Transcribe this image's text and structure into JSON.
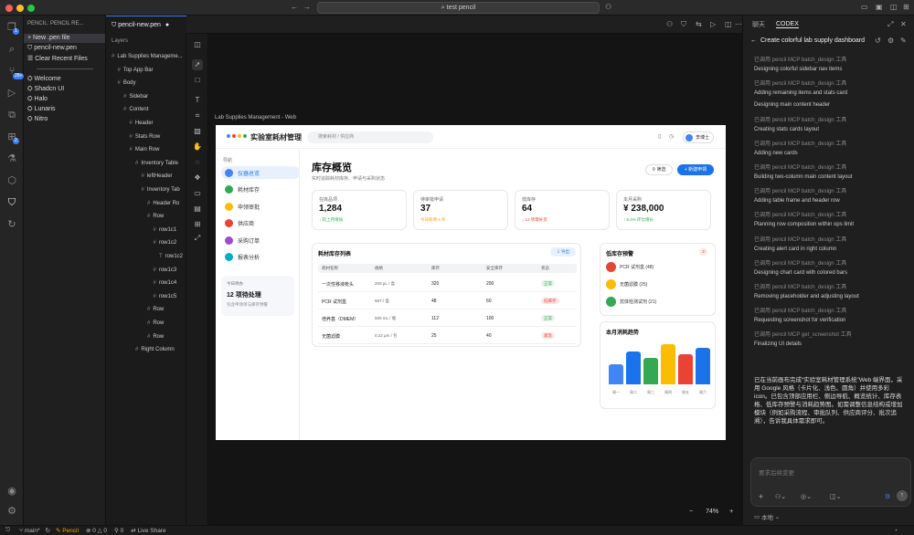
{
  "window": {
    "search_text": "test pencil"
  },
  "explorer": {
    "header": "PENCIL: PENCIL RE...",
    "items": [
      "New .pen file",
      "pencil-new.pen",
      "Clear Recent Files",
      "Welcome",
      "Shadcn UI",
      "Halo",
      "Lunaris",
      "Nitro"
    ]
  },
  "editor": {
    "tab_label": "pencil-new.pen"
  },
  "layers": {
    "title": "Layers",
    "items": [
      "Lab Supplies Manageme...",
      "Top App Bar",
      "Body",
      "Sidebar",
      "Content",
      "Header",
      "Stats Row",
      "Main Row",
      "Inventory Table",
      "leftHeader",
      "Inventory Tab",
      "Header Ro",
      "Row",
      "row1c1",
      "row1c2",
      "row1c2",
      "row1c3",
      "row1c4",
      "row1c5",
      "Row",
      "Row",
      "Row",
      "Right Column"
    ]
  },
  "canvas": {
    "frame_label": "Lab Supplies Management - Web",
    "zoom": "74%"
  },
  "app": {
    "title": "实验室耗材管理",
    "search_placeholder": "搜索耗材 / 供应商",
    "user": "李博士",
    "nav_header": "导航",
    "nav": [
      {
        "label": "仪器总览",
        "color": "#4285f4"
      },
      {
        "label": "耗材库存",
        "color": "#34a853"
      },
      {
        "label": "申领审批",
        "color": "#fbbc04"
      },
      {
        "label": "供应商",
        "color": "#ea4335"
      },
      {
        "label": "采购订单",
        "color": "#9c4dcc"
      },
      {
        "label": "报表分析",
        "color": "#00acc1"
      }
    ],
    "today": {
      "label": "今日待办",
      "value": "12 项待处理",
      "sub": "包含申领单与库存预警"
    },
    "page_title": "库存概览",
    "page_sub": "实时追踪耗材库存、申请与采购状态",
    "filter_btn": "筛选",
    "new_btn": "新建申领",
    "stats": [
      {
        "label": "在库品项",
        "value": "1,284",
        "sub": "↑ 较上月增加",
        "color": "#34a853"
      },
      {
        "label": "待审批申请",
        "value": "37",
        "sub": "今日新增 5 条",
        "color": "#f59e0b"
      },
      {
        "label": "低库存",
        "value": "64",
        "sub": "↓ 12 项需补货",
        "color": "#ea4335"
      },
      {
        "label": "本月采购",
        "value": "¥ 238,000",
        "sub": "↑ 6.4% 环比增长",
        "color": "#34a853"
      }
    ],
    "table": {
      "title": "耗材库存列表",
      "export": "导出",
      "headers": [
        "耗材名称",
        "规格",
        "库存",
        "安全库存",
        "状态"
      ],
      "rows": [
        [
          "一次性移液枪头",
          "200 μL / 盒",
          "320",
          "200",
          "正常"
        ],
        [
          "PCR 试剂盒",
          "96T / 盒",
          "48",
          "60",
          "低库存"
        ],
        [
          "培养基（DMEM）",
          "500 mL / 瓶",
          "112",
          "100",
          "正常"
        ],
        [
          "无菌滤膜",
          "0.22 μm / 包",
          "25",
          "40",
          "紧急"
        ]
      ],
      "status_colors": {
        "正常": "#34a853",
        "低库存": "#ea4335",
        "紧急": "#ea4335"
      }
    },
    "alerts": {
      "title": "低库存预警",
      "count": "3",
      "items": [
        {
          "label": "PCR 试剂盒 (48)",
          "color": "#ea4335"
        },
        {
          "label": "无菌滤膜 (25)",
          "color": "#fbbc04"
        },
        {
          "label": "抗体检测试剂 (21)",
          "color": "#34a853"
        }
      ]
    },
    "chart_data": {
      "type": "bar",
      "title": "本月消耗趋势",
      "categories": [
        "周一",
        "周二",
        "周三",
        "周四",
        "周五",
        "周六"
      ],
      "values": [
        22,
        35,
        28,
        43,
        32,
        39
      ],
      "colors": [
        "#4285f4",
        "#1a73e8",
        "#34a853",
        "#fbbc04",
        "#ea4335",
        "#1a73e8"
      ],
      "ylim": [
        0,
        45
      ]
    }
  },
  "codex": {
    "tabs": [
      "聊天",
      "CODEX"
    ],
    "task_title": "Create colorful lab supply dashboard",
    "log": [
      {
        "t": "tool",
        "text": "已调用 pencil MCP batch_design 工具"
      },
      {
        "t": "msg",
        "text": "Designing colorful sidebar nav items"
      },
      {
        "t": "tool",
        "text": "已调用 pencil MCP batch_design 工具"
      },
      {
        "t": "msg",
        "text": "Adding remaining items and stats card"
      },
      {
        "t": "msg",
        "text": "Designing main content header"
      },
      {
        "t": "tool",
        "text": "已调用 pencil MCP batch_design 工具"
      },
      {
        "t": "msg",
        "text": "Creating stats cards layout"
      },
      {
        "t": "tool",
        "text": "已调用 pencil MCP batch_design 工具"
      },
      {
        "t": "msg",
        "text": "Adding new cards"
      },
      {
        "t": "tool",
        "text": "已调用 pencil MCP batch_design 工具"
      },
      {
        "t": "msg",
        "text": "Building two-column main content layout"
      },
      {
        "t": "tool",
        "text": "已调用 pencil MCP batch_design 工具"
      },
      {
        "t": "msg",
        "text": "Adding table frame and header row"
      },
      {
        "t": "tool",
        "text": "已调用 pencil MCP batch_design 工具"
      },
      {
        "t": "msg",
        "text": "Planning row composition within ops limit"
      },
      {
        "t": "tool",
        "text": "已调用 pencil MCP batch_design 工具"
      },
      {
        "t": "msg",
        "text": "Creating alert card in right column"
      },
      {
        "t": "tool",
        "text": "已调用 pencil MCP batch_design 工具"
      },
      {
        "t": "msg",
        "text": "Designing chart card with colored bars"
      },
      {
        "t": "tool",
        "text": "已调用 pencil MCP batch_design 工具"
      },
      {
        "t": "msg",
        "text": "Removing placeholder and adjusting layout"
      },
      {
        "t": "tool",
        "text": "已调用 pencil MCP batch_design 工具"
      },
      {
        "t": "msg",
        "text": "Requesting screenshot for verification"
      },
      {
        "t": "tool",
        "text": "已调用 pencil MCP get_screenshot 工具"
      },
      {
        "t": "msg",
        "text": "Finalizing UI details"
      }
    ],
    "summary": "已在当前画布完成“实验室耗材管理系统”Web 端界面，采用 Google 风格（卡片化、浅色、圆角）并使用多彩 icon。已包含顶部应用栏、侧边导航、概览统计、库存表格、低库存预警与消耗趋势图。如需调整信息结构或增加模块（例如采购流程、审批队列、供应商评分、批次追溯），告诉我具体需求即可。",
    "input_placeholder": "要求后续变更",
    "bottom_label": "本地"
  },
  "status": {
    "branch": "main*",
    "pencil": "Pencil",
    "problems": "0 △ 0",
    "ports": "0",
    "live_share": "Live Share"
  }
}
